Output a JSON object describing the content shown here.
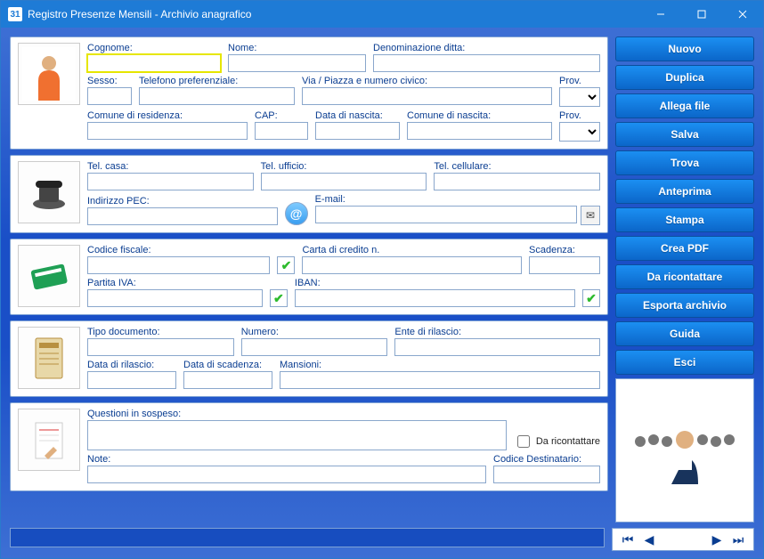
{
  "window": {
    "title": "Registro Presenze Mensili - Archivio anagrafico"
  },
  "thumbs": {
    "person": "",
    "phone": "",
    "card": "",
    "doc": "",
    "notes": "",
    "crowd": ""
  },
  "labels": {
    "cognome": "Cognome:",
    "nome": "Nome:",
    "denom": "Denominazione ditta:",
    "sesso": "Sesso:",
    "tel_pref": "Telefono preferenziale:",
    "via": "Via / Piazza e numero civico:",
    "prov": "Prov.",
    "comune_res": "Comune di residenza:",
    "cap": "CAP:",
    "data_n": "Data di nascita:",
    "comune_n": "Comune di nascita:",
    "tel_casa": "Tel. casa:",
    "tel_uff": "Tel. ufficio:",
    "tel_cell": "Tel. cellulare:",
    "pec": "Indirizzo PEC:",
    "email": "E-mail:",
    "cf": "Codice fiscale:",
    "cc": "Carta di credito n.",
    "scad": "Scadenza:",
    "piva": "Partita IVA:",
    "iban": "IBAN:",
    "tipo_doc": "Tipo documento:",
    "numero": "Numero:",
    "ente": "Ente di rilascio:",
    "data_ril": "Data di rilascio:",
    "data_scad": "Data di scadenza:",
    "mansioni": "Mansioni:",
    "questioni": "Questioni in sospeso:",
    "daric": "Da ricontattare",
    "note": "Note:",
    "cdest": "Codice Destinatario:"
  },
  "values": {
    "cognome": "",
    "nome": "",
    "denom": "",
    "sesso": "",
    "tel_pref": "",
    "via": "",
    "prov": "",
    "comune_res": "",
    "cap": "",
    "data_n": "",
    "comune_n": "",
    "prov2": "",
    "tel_casa": "",
    "tel_uff": "",
    "tel_cell": "",
    "pec": "",
    "email": "",
    "cf": "",
    "cc": "",
    "scad": "",
    "piva": "",
    "iban": "",
    "tipo_doc": "",
    "numero": "",
    "ente": "",
    "data_ril": "",
    "data_scad": "",
    "mansioni": "",
    "questioni": "",
    "daric": false,
    "note": "",
    "cdest": ""
  },
  "buttons": {
    "nuovo": "Nuovo",
    "duplica": "Duplica",
    "allega": "Allega file",
    "salva": "Salva",
    "trova": "Trova",
    "anteprima": "Anteprima",
    "stampa": "Stampa",
    "pdf": "Crea PDF",
    "daric": "Da ricontattare",
    "esporta": "Esporta archivio",
    "guida": "Guida",
    "esci": "Esci"
  }
}
